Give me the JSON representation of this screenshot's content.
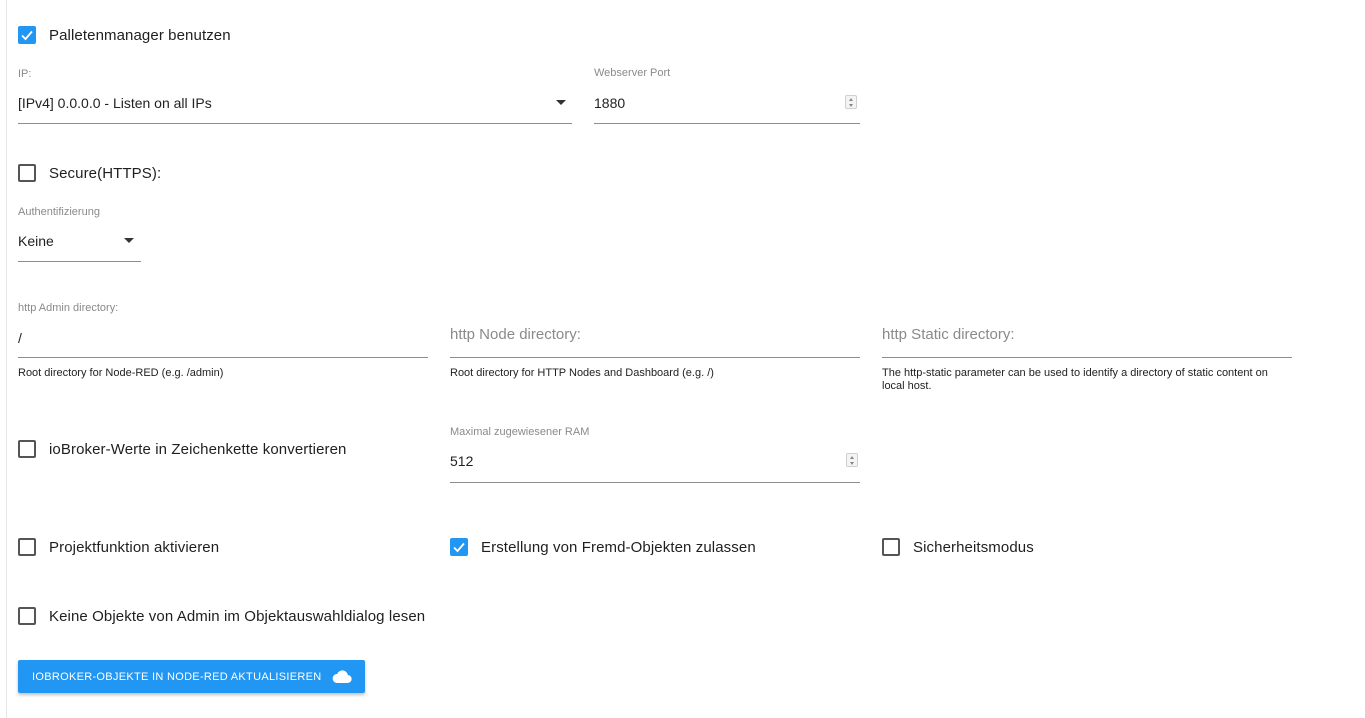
{
  "colors": {
    "accent": "#2196f3"
  },
  "palette_manager": {
    "label": "Palletenmanager benutzen",
    "checked": true
  },
  "ip": {
    "label": "IP:",
    "value": "[IPv4] 0.0.0.0 - Listen on all IPs"
  },
  "port": {
    "label": "Webserver Port",
    "value": "1880"
  },
  "secure": {
    "label": "Secure(HTTPS):",
    "checked": false
  },
  "auth": {
    "label": "Authentifizierung",
    "value": "Keine"
  },
  "admin_dir": {
    "label": "http Admin directory:",
    "value": "/",
    "helper": "Root directory for Node-RED (e.g. /admin)"
  },
  "node_dir": {
    "placeholder": "http Node directory:",
    "helper": "Root directory for HTTP Nodes and Dashboard (e.g. /)"
  },
  "static_dir": {
    "placeholder": "http Static directory:",
    "helper": "The http-static parameter can be used to identify a directory of static content on local host."
  },
  "convert_values": {
    "label": "ioBroker-Werte in Zeichenkette konvertieren",
    "checked": false
  },
  "max_ram": {
    "label": "Maximal zugewiesener RAM",
    "value": "512"
  },
  "project": {
    "label": "Projektfunktion aktivieren",
    "checked": false
  },
  "foreign_objects": {
    "label": "Erstellung von Fremd-Objekten zulassen",
    "checked": true
  },
  "safe_mode": {
    "label": "Sicherheitsmodus",
    "checked": false
  },
  "no_admin_objects": {
    "label": "Keine Objekte von Admin im Objektauswahldialog lesen",
    "checked": false
  },
  "update_button": {
    "label": "IOBROKER-OBJEKTE IN NODE-RED AKTUALISIEREN",
    "icon": "cloud-icon"
  }
}
